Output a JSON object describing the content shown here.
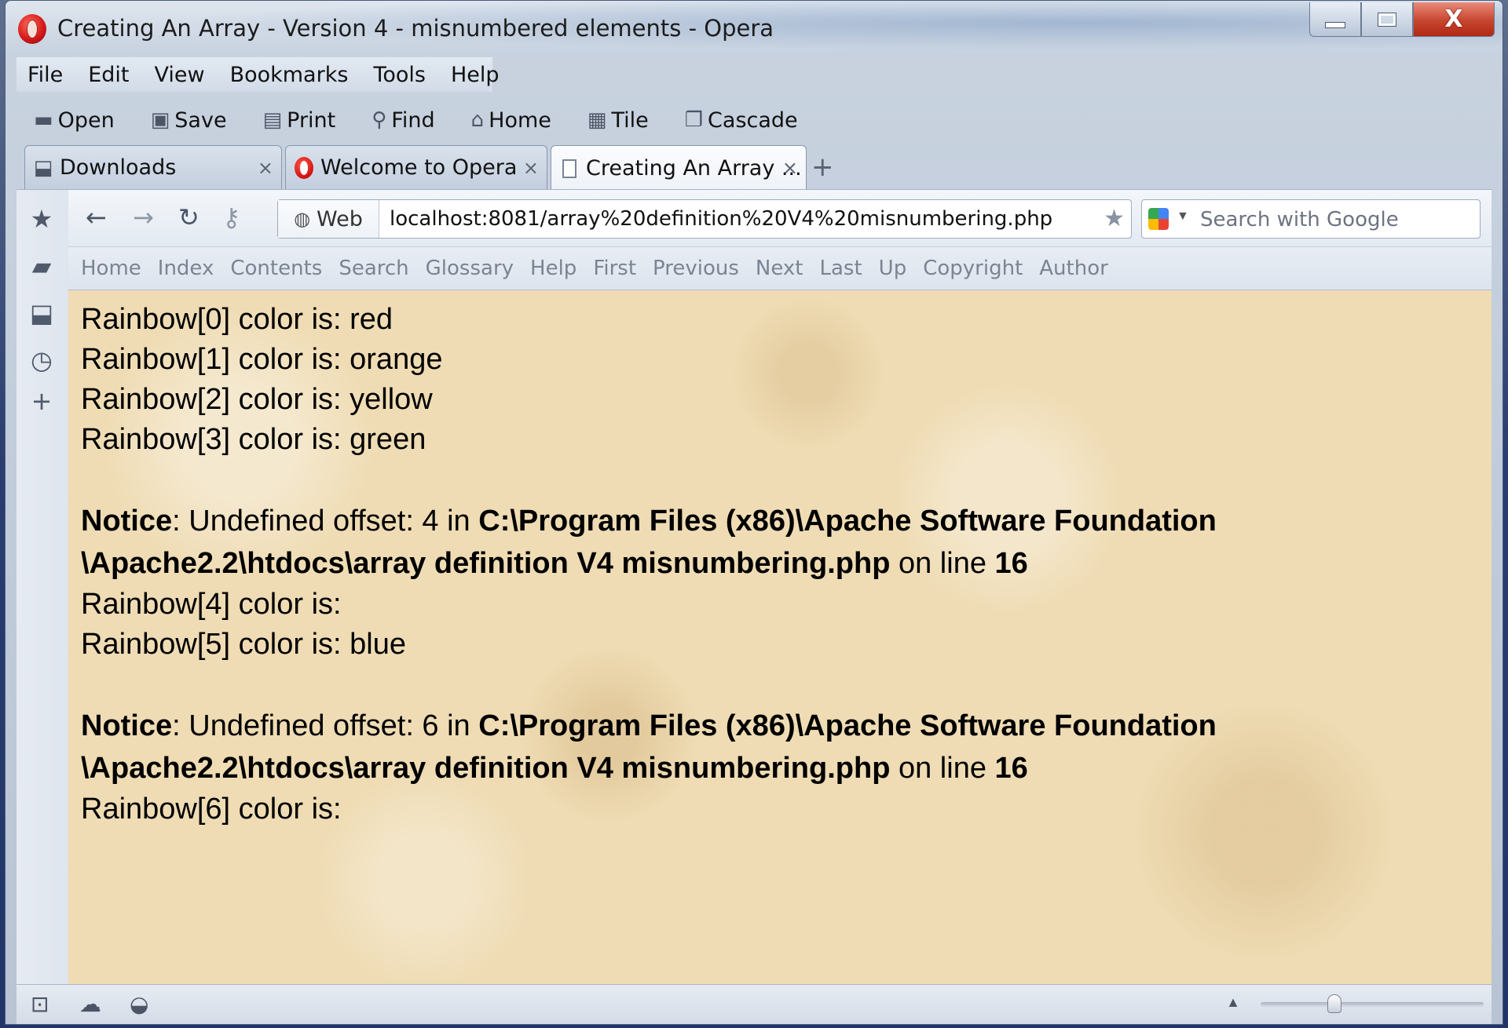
{
  "window": {
    "title": "Creating An Array - Version 4 - misnumbered elements - Opera",
    "controls": {
      "minimize_icon": "minimize-icon",
      "maximize_icon": "maximize-icon",
      "close_glyph": "X"
    }
  },
  "menubar": {
    "items": [
      {
        "label": "File"
      },
      {
        "label": "Edit"
      },
      {
        "label": "View"
      },
      {
        "label": "Bookmarks"
      },
      {
        "label": "Tools"
      },
      {
        "label": "Help"
      }
    ]
  },
  "bookmark_bar": {
    "items": [
      {
        "label": "Open",
        "icon": "folder-icon",
        "glyph": "▬"
      },
      {
        "label": "Save",
        "icon": "save-icon",
        "glyph": "▣"
      },
      {
        "label": "Print",
        "icon": "print-icon",
        "glyph": "▤"
      },
      {
        "label": "Find",
        "icon": "find-icon",
        "glyph": "⚲"
      },
      {
        "label": "Home",
        "icon": "home-icon",
        "glyph": "⌂"
      },
      {
        "label": "Tile",
        "icon": "tile-icon",
        "glyph": "▦"
      },
      {
        "label": "Cascade",
        "icon": "cascade-icon",
        "glyph": "❐"
      }
    ]
  },
  "tabs": [
    {
      "label": "Downloads",
      "icon": "downloads-icon",
      "close": "×"
    },
    {
      "label": "Welcome to Opera",
      "icon": "opera-icon",
      "close": "×"
    },
    {
      "label": "Creating An Array ...",
      "icon": "document-icon",
      "close": "×"
    }
  ],
  "new_tab_glyph": "+",
  "address": {
    "back": "←",
    "forward": "→",
    "reload": "↻",
    "wand": "⚷",
    "web_label": "Web",
    "url": "localhost:8081/array%20definition%20V4%20misnumbering.php",
    "bookmark_star": "★",
    "search_placeholder": "Search with Google"
  },
  "sidebar": {
    "icons": [
      {
        "name": "bookmarks-panel-icon",
        "glyph": "★"
      },
      {
        "name": "notes-panel-icon",
        "glyph": "▰"
      },
      {
        "name": "downloads-panel-icon",
        "glyph": "⬓"
      },
      {
        "name": "history-panel-icon",
        "glyph": "◷"
      },
      {
        "name": "add-panel-icon",
        "glyph": "+"
      }
    ]
  },
  "site_nav": {
    "links": [
      "Home",
      "Index",
      "Contents",
      "Search",
      "Glossary",
      "Help",
      "First",
      "Previous",
      "Next",
      "Last",
      "Up",
      "Copyright",
      "Author"
    ]
  },
  "page": {
    "lines_a": [
      "Rainbow[0] color is: red",
      "Rainbow[1] color is: orange",
      "Rainbow[2] color is: yellow",
      "Rainbow[3] color is: green"
    ],
    "notice1": {
      "label": "Notice",
      "message": ": Undefined offset: 4 in ",
      "path": "C:\\Program Files (x86)\\Apache Software Foundation \\Apache2.2\\htdocs\\array definition V4 misnumbering.php",
      "on_line": " on line ",
      "line": "16"
    },
    "lines_b": [
      "Rainbow[4] color is:",
      "Rainbow[5] color is: blue"
    ],
    "notice2": {
      "label": "Notice",
      "message": ": Undefined offset: 6 in ",
      "path": "C:\\Program Files (x86)\\Apache Software Foundation \\Apache2.2\\htdocs\\array definition V4 misnumbering.php",
      "on_line": " on line ",
      "line": "16"
    },
    "lines_c": [
      "Rainbow[6] color is:"
    ]
  },
  "statusbar": {
    "panel_toggle": "⊡",
    "cloud": "☁",
    "speed_dial": "◒",
    "zoom_up": "▲",
    "zoom_level": 0.33
  },
  "colors": {
    "page_background": "#efdcb4",
    "window_frame": "#c9d3e0",
    "nav_link": "#7b8492",
    "close_button": "#c7442e"
  }
}
